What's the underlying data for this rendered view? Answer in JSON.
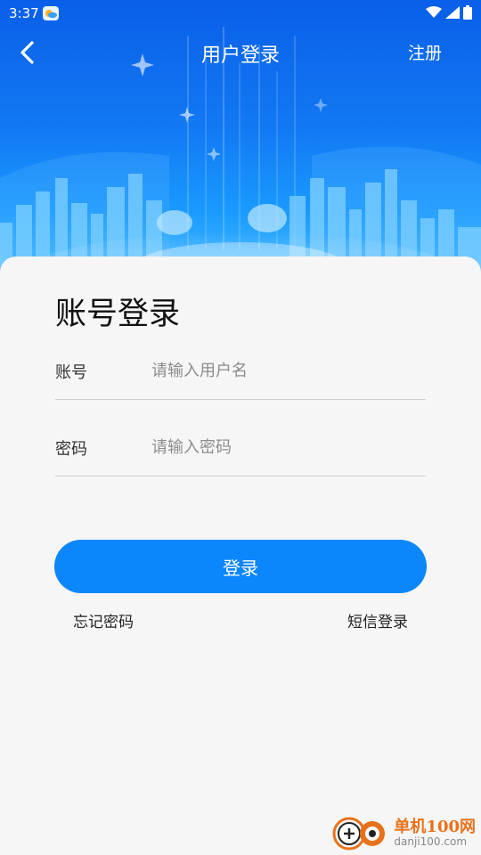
{
  "status_bar": {
    "time": "3:37"
  },
  "header": {
    "title": "用户登录",
    "register_label": "注册"
  },
  "form": {
    "heading": "账号登录",
    "account": {
      "label": "账号",
      "placeholder": "请输入用户名",
      "value": ""
    },
    "password": {
      "label": "密码",
      "placeholder": "请输入密码",
      "value": ""
    },
    "login_label": "登录",
    "forgot_label": "忘记密码",
    "sms_label": "短信登录"
  },
  "watermark": {
    "name": "单机100网",
    "url": "danji100.com"
  },
  "colors": {
    "accent": "#0c86fb",
    "hero_top": "#0a5fe8",
    "hero_bottom": "#4fc1ff",
    "watermark": "#e8721c"
  },
  "icons": {
    "back": "chevron-left-icon",
    "wifi": "wifi-icon",
    "signal": "signal-icon",
    "battery": "battery-icon",
    "app": "weather-app-icon"
  }
}
